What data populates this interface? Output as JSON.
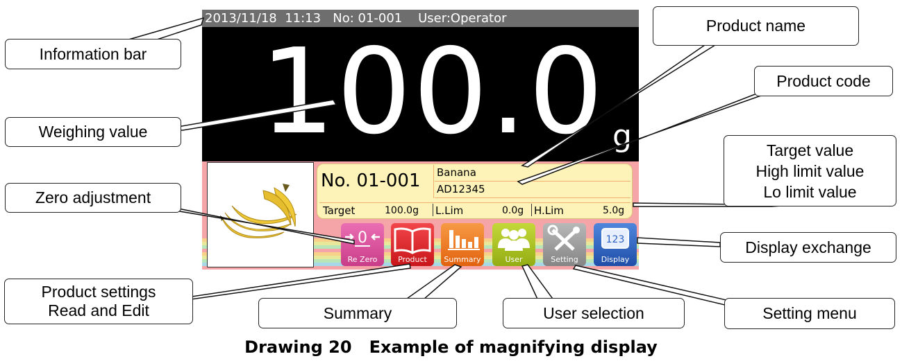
{
  "screen": {
    "info_bar": "2013/11/18  11:13   No: 01-001    User:Operator",
    "weighing_value": "100.0",
    "unit": "g",
    "product_no": "No. 01-001",
    "product_name": "Banana",
    "product_code": "AD12345",
    "target_label": "Target",
    "target_value": "100.0g",
    "llim_label": "L.Lim",
    "llim_value": "0.0g",
    "hlim_label": "H.Lim",
    "hlim_value": "5.0g",
    "buttons": [
      {
        "label": "Re Zero",
        "icon": "re-zero-icon",
        "color": "#d94f9b"
      },
      {
        "label": "Product",
        "icon": "book-icon",
        "color": "#e8262b"
      },
      {
        "label": "Summary",
        "icon": "bar-chart-icon",
        "color": "#f07a1a"
      },
      {
        "label": "User",
        "icon": "users-icon",
        "color": "#a8c21a"
      },
      {
        "label": "Setting",
        "icon": "tools-icon",
        "color": "#9a9a9a"
      },
      {
        "label": "Display",
        "icon": "display-icon",
        "color": "#2a5fc2"
      }
    ],
    "display_icon_text": "123"
  },
  "callouts": {
    "information_bar": "Information bar",
    "weighing_value": "Weighing value",
    "zero_adjustment": "Zero adjustment",
    "product_settings_1": "Product settings",
    "product_settings_2": "Read and Edit",
    "summary": "Summary",
    "user_selection": "User selection",
    "setting_menu": "Setting menu",
    "display_exchange": "Display exchange",
    "product_name": "Product name",
    "product_code": "Product code",
    "target_1": "Target value",
    "target_2": "High limit value",
    "target_3": "Lo limit value"
  },
  "caption": "Drawing 20   Example of magnifying display"
}
